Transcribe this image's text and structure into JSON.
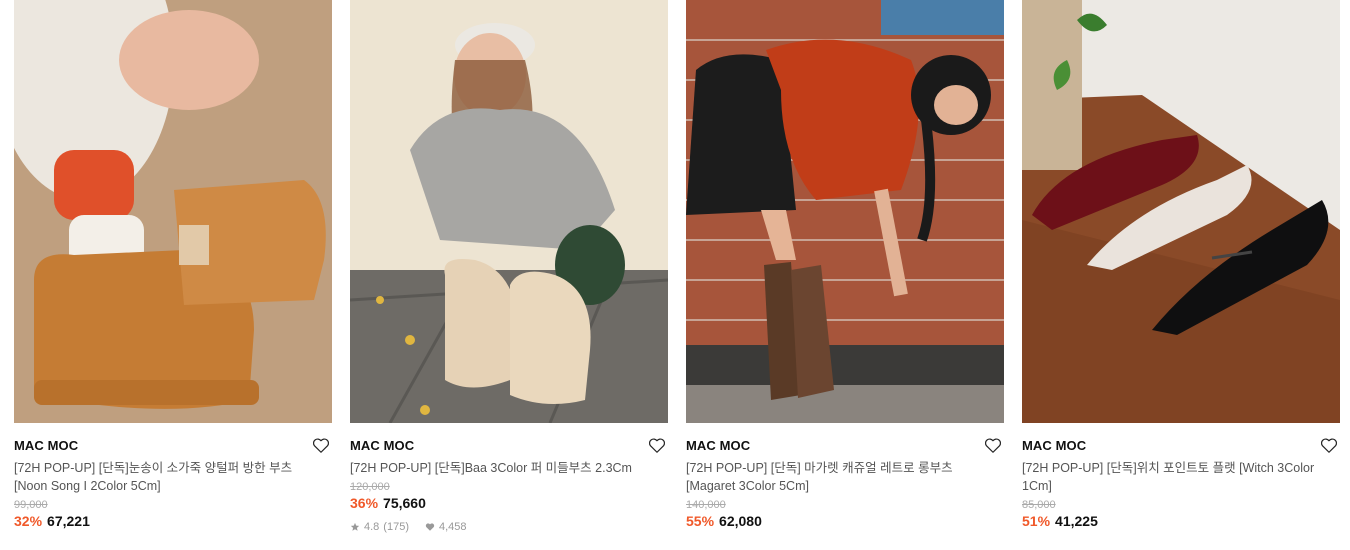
{
  "products": [
    {
      "brand": "MAC MOC",
      "name": "[72H POP-UP] [단독]눈송이 소가죽 양털퍼 방한 부츠 [Noon Song I 2Color 5Cm]",
      "original_price": "99,000",
      "discount": "32%",
      "price": "67,221"
    },
    {
      "brand": "MAC MOC",
      "name": "[72H POP-UP] [단독]Baa 3Color 퍼 미들부츠 2.3Cm",
      "original_price": "120,000",
      "discount": "36%",
      "price": "75,660",
      "rating": "4.8",
      "review_count": "(175)",
      "likes": "4,458"
    },
    {
      "brand": "MAC MOC",
      "name": "[72H POP-UP] [단독] 마가렛 캐쥬얼 레트로 롱부츠 [Magaret 3Color 5Cm]",
      "original_price": "140,000",
      "discount": "55%",
      "price": "62,080"
    },
    {
      "brand": "MAC MOC",
      "name": "[72H POP-UP] [단독]위치 포인트토 플랫 [Witch 3Color 1Cm]",
      "original_price": "85,000",
      "discount": "51%",
      "price": "41,225"
    }
  ],
  "colors": {
    "discount": "#f0592a",
    "text": "#111111",
    "muted": "#999999"
  },
  "icons": {
    "wishlist": "heart-outline-icon",
    "rating": "star-icon",
    "likes": "heart-filled-icon"
  }
}
